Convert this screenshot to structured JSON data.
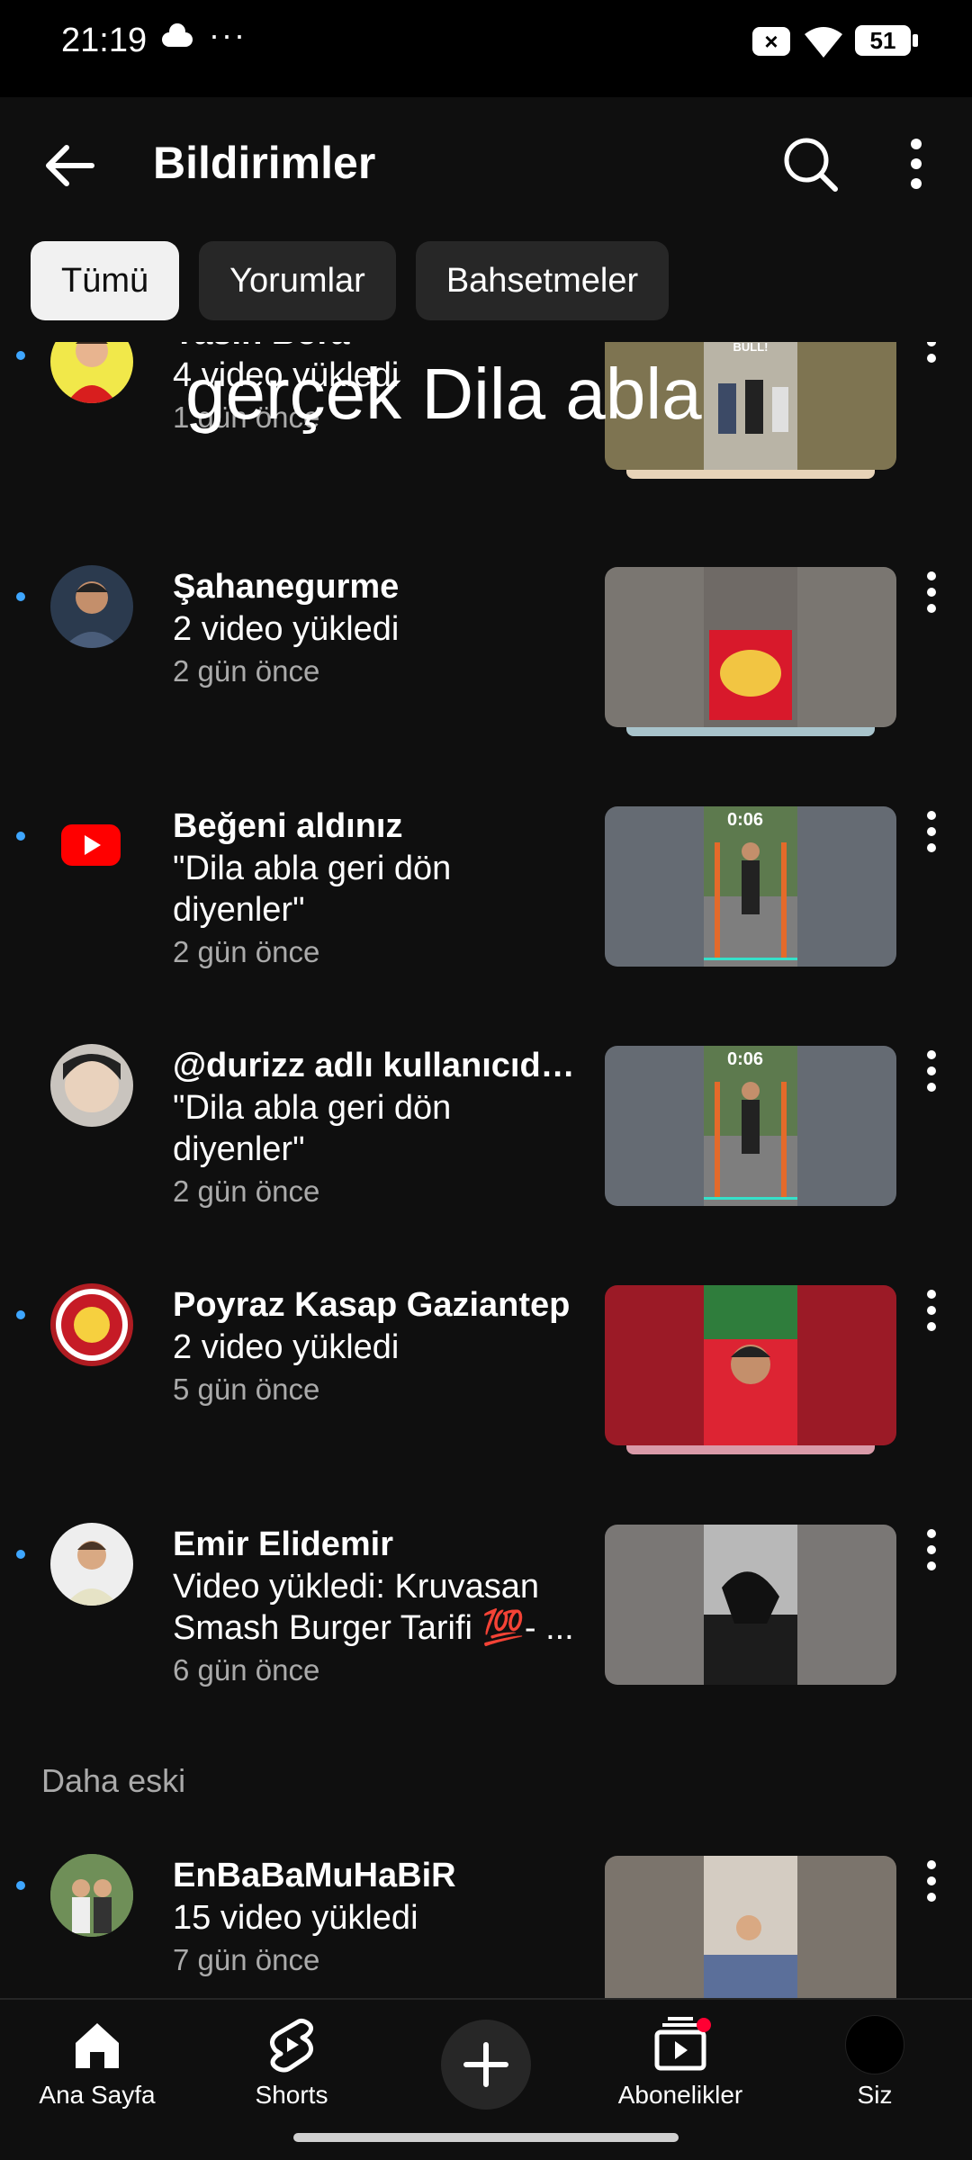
{
  "status": {
    "time": "21:19",
    "dots": "···",
    "battery": "51"
  },
  "header": {
    "title": "Bildirimler"
  },
  "chips": [
    {
      "label": "Tümü",
      "active": true
    },
    {
      "label": "Yorumlar",
      "active": false
    },
    {
      "label": "Bahsetmeler",
      "active": false
    }
  ],
  "overlay": {
    "text": "gerçek Dila abla"
  },
  "notifications": [
    {
      "name": "Yasin Bora",
      "desc": "4 video yükledi",
      "time": "1 gün önce"
    },
    {
      "name": "Şahanegurme",
      "desc": "2 video yükledi",
      "time": "2 gün önce"
    },
    {
      "name": "Beğeni aldınız",
      "desc": "\"Dila abla geri dön diyenler\"",
      "time": "2 gün önce"
    },
    {
      "name": "@durizz adlı kullanıcıda...",
      "desc": "\"Dila abla geri dön diyenler\"",
      "time": "2 gün önce"
    },
    {
      "name": "Poyraz Kasap Gaziantep",
      "desc": "2 video yükledi",
      "time": "5 gün önce"
    },
    {
      "name": "Emir Elidemir",
      "desc": "Video yükledi: Kruvasan Smash Burger Tarifi 💯- ...",
      "time": "6 gün önce"
    },
    {
      "name": "EnBaBaMuHaBiR",
      "desc": "15 video yükledi",
      "time": "7 gün önce"
    }
  ],
  "section": {
    "older_label": "Daha eski"
  },
  "thumb_texts": {
    "cinar": "ÇINAR VE ALİ BULL!",
    "timer": "0:06"
  },
  "bottom_nav": [
    {
      "label": "Ana Sayfa"
    },
    {
      "label": "Shorts"
    },
    {
      "label": "Abonelikler"
    },
    {
      "label": "Siz"
    }
  ],
  "colors": {
    "background": "#0f0f0f",
    "unread_dot": "#3ea6ff",
    "youtube_red": "#ff0000"
  }
}
